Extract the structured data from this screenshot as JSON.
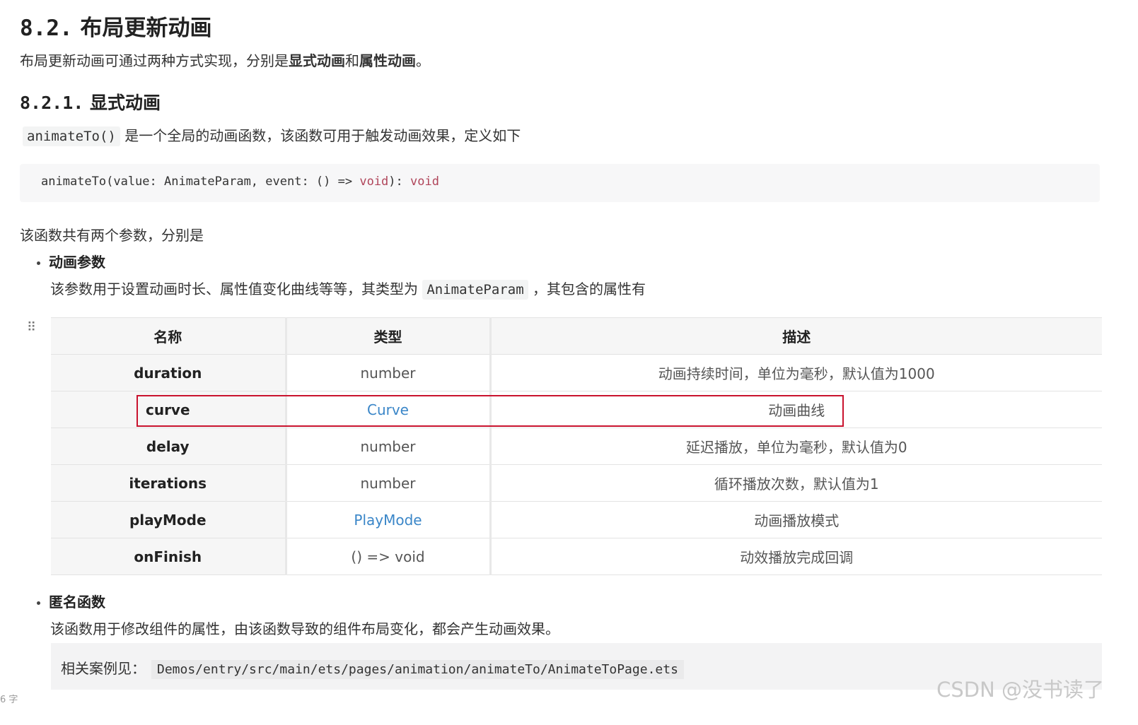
{
  "heading": {
    "num": "8.2.",
    "text": "布局更新动画"
  },
  "intro": {
    "prefix": "布局更新动画可通过两种方式实现，分别是",
    "bold1": "显式动画",
    "mid": "和",
    "bold2": "属性动画",
    "suffix": "。"
  },
  "subheading": {
    "num": "8.2.1.",
    "text": "显式动画"
  },
  "animate_desc": {
    "code": "animateTo()",
    "text": " 是一个全局的动画函数，该函数可用于触发动画效果，定义如下"
  },
  "code_block": {
    "plain": "animateTo(value: AnimateParam, event: () => ",
    "kw1": "void",
    "mid": "): ",
    "kw2": "void"
  },
  "params_intro": "该函数共有两个参数，分别是",
  "bullet1": {
    "title": "动画参数",
    "desc_prefix": "该参数用于设置动画时长、属性值变化曲线等等，其类型为 ",
    "desc_code": "AnimateParam",
    "desc_suffix": " ，其包含的属性有"
  },
  "table": {
    "headers": [
      "名称",
      "类型",
      "描述"
    ],
    "rows": [
      {
        "name": "duration",
        "type": "number",
        "desc": "动画持续时间，单位为毫秒，默认值为1000"
      },
      {
        "name": "curve",
        "type": "Curve",
        "desc": "动画曲线"
      },
      {
        "name": "delay",
        "type": "number",
        "desc": "延迟播放，单位为毫秒，默认值为0"
      },
      {
        "name": "iterations",
        "type": "number",
        "desc": "循环播放次数，默认值为1"
      },
      {
        "name": "playMode",
        "type": "PlayMode",
        "desc": "动画播放模式"
      },
      {
        "name": "onFinish",
        "type": "() => void",
        "desc": "动效播放完成回调"
      }
    ]
  },
  "bullet2": {
    "title": "匿名函数",
    "desc": "该函数用于修改组件的属性，由该函数导致的组件布局变化，都会产生动画效果。"
  },
  "note": {
    "label": "相关案例见：",
    "path": "Demos/entry/src/main/ets/pages/animation/animateTo/AnimateToPage.ets"
  },
  "watermark": "CSDN @没书读了",
  "word_count": "6 字",
  "colors": {
    "link": "#3a86c8",
    "highlight_border": "#c9132e",
    "keyword": "#b0455a"
  }
}
